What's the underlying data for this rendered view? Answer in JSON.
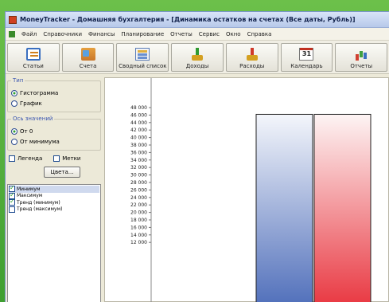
{
  "window": {
    "title": "MoneyTracker - Домашняя бухгалтерия - [Динамика остатков на счетах (Все даты, Рубль)]"
  },
  "menu": [
    "Файл",
    "Справочники",
    "Финансы",
    "Планирование",
    "Отчеты",
    "Сервис",
    "Окно",
    "Справка"
  ],
  "toolbar": {
    "buttons": [
      {
        "label": "Статьи",
        "icon": "articles-icon"
      },
      {
        "label": "Счета",
        "icon": "accounts-icon"
      },
      {
        "label": "Сводный список",
        "icon": "summary-list-icon"
      },
      {
        "label": "Доходы",
        "icon": "income-icon"
      },
      {
        "label": "Расходы",
        "icon": "expense-icon"
      },
      {
        "label": "Календарь",
        "icon": "calendar-icon",
        "badge": "31"
      },
      {
        "label": "Отчеты",
        "icon": "reports-icon"
      }
    ]
  },
  "panel": {
    "type_group": {
      "legend": "Тип",
      "options": [
        {
          "label": "Гистограмма",
          "selected": true
        },
        {
          "label": "График",
          "selected": false
        }
      ]
    },
    "axis_group": {
      "legend": "Ось значений",
      "options": [
        {
          "label": "От 0",
          "selected": true
        },
        {
          "label": "От минимума",
          "selected": false
        }
      ]
    },
    "legend_checkbox": {
      "label": "Легенда",
      "checked": false
    },
    "labels_checkbox": {
      "label": "Метки",
      "checked": false
    },
    "colors_button": "Цвета...",
    "series": [
      {
        "label": "Минимум",
        "checked": true,
        "selected": true
      },
      {
        "label": "Максимум",
        "checked": true,
        "selected": false
      },
      {
        "label": "Тренд (минимум)",
        "checked": true,
        "selected": false
      },
      {
        "label": "Тренд (максимум)",
        "checked": false,
        "selected": false
      }
    ]
  },
  "chart_data": {
    "type": "bar",
    "ticks": [
      "48 000",
      "46 000",
      "44 000",
      "42 000",
      "40 000",
      "38 000",
      "36 000",
      "34 000",
      "32 000",
      "30 000",
      "28 000",
      "26 000",
      "24 000",
      "22 000",
      "20 000",
      "18 000",
      "16 000",
      "14 000",
      "12 000"
    ],
    "ylim": [
      12000,
      48000
    ],
    "series": [
      {
        "name": "Минимум",
        "values": [
          46200
        ],
        "color_top": "#f4f6fb",
        "color_bottom": "#4a6ab8"
      },
      {
        "name": "Максимум",
        "values": [
          46200
        ],
        "color_top": "#fdf4f4",
        "color_bottom": "#e8303a"
      }
    ]
  }
}
